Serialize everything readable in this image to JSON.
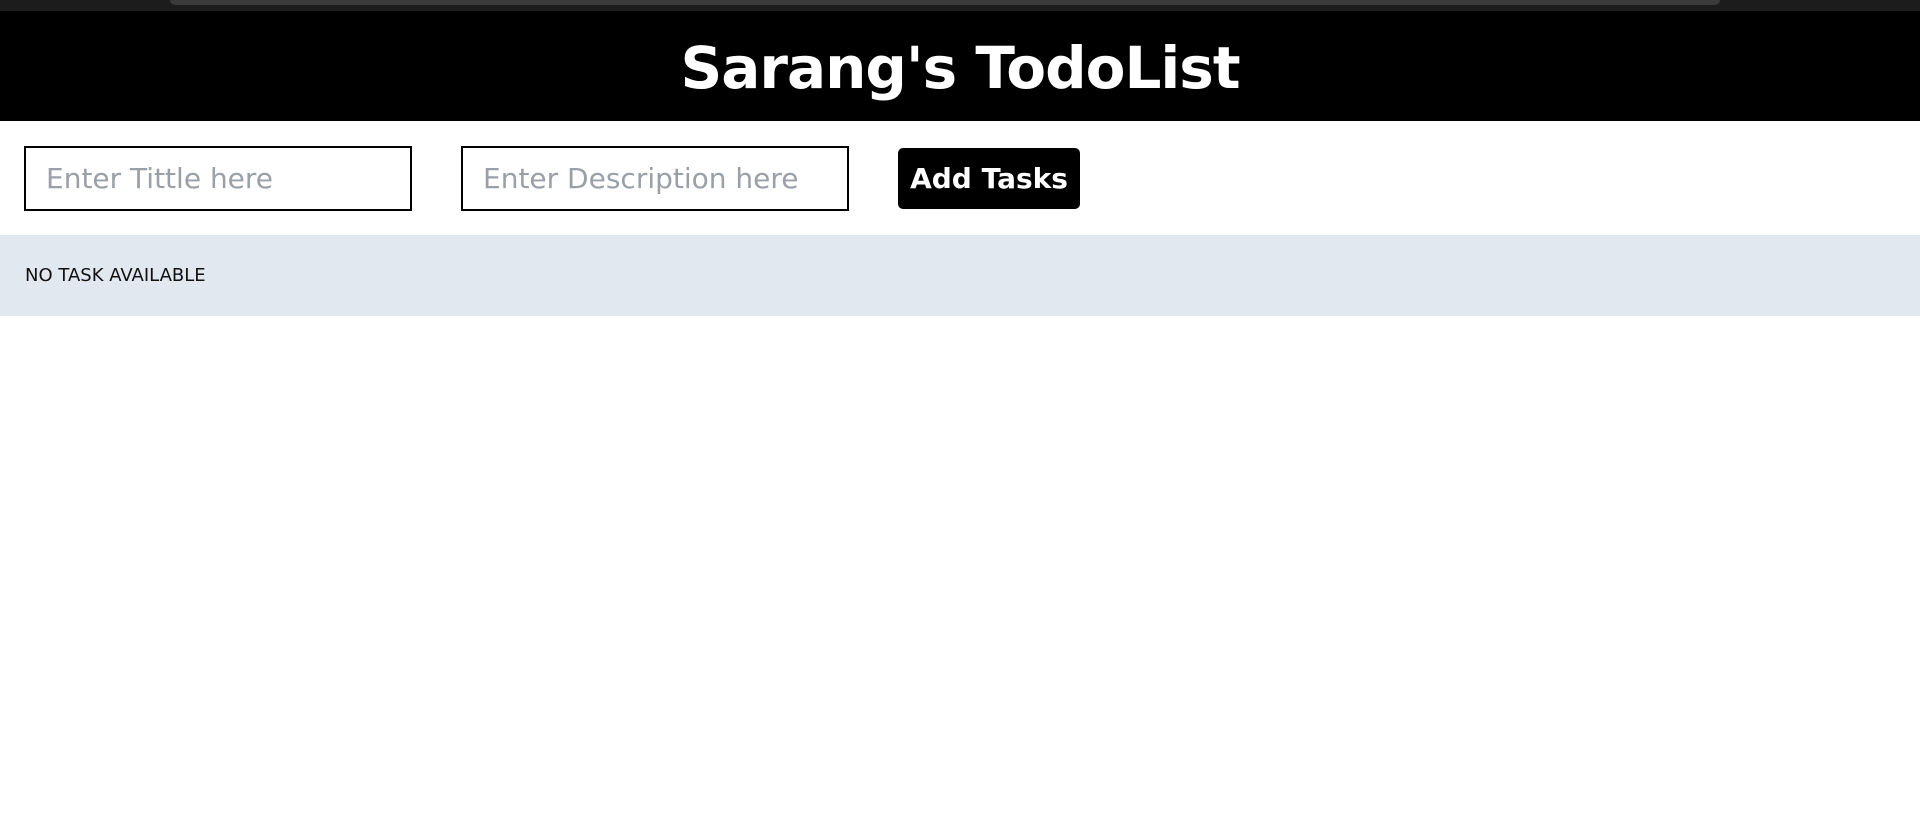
{
  "header": {
    "title": "Sarang's TodoList"
  },
  "form": {
    "title_placeholder": "Enter Tittle here",
    "title_value": "",
    "description_placeholder": "Enter Description here",
    "description_value": "",
    "add_button_label": "Add Tasks"
  },
  "tasks": {
    "empty_message": "NO TASK AVAILABLE",
    "items": []
  },
  "colors": {
    "header_bg": "#000000",
    "header_text": "#ffffff",
    "button_bg": "#000000",
    "panel_bg": "#e2e8f0"
  }
}
